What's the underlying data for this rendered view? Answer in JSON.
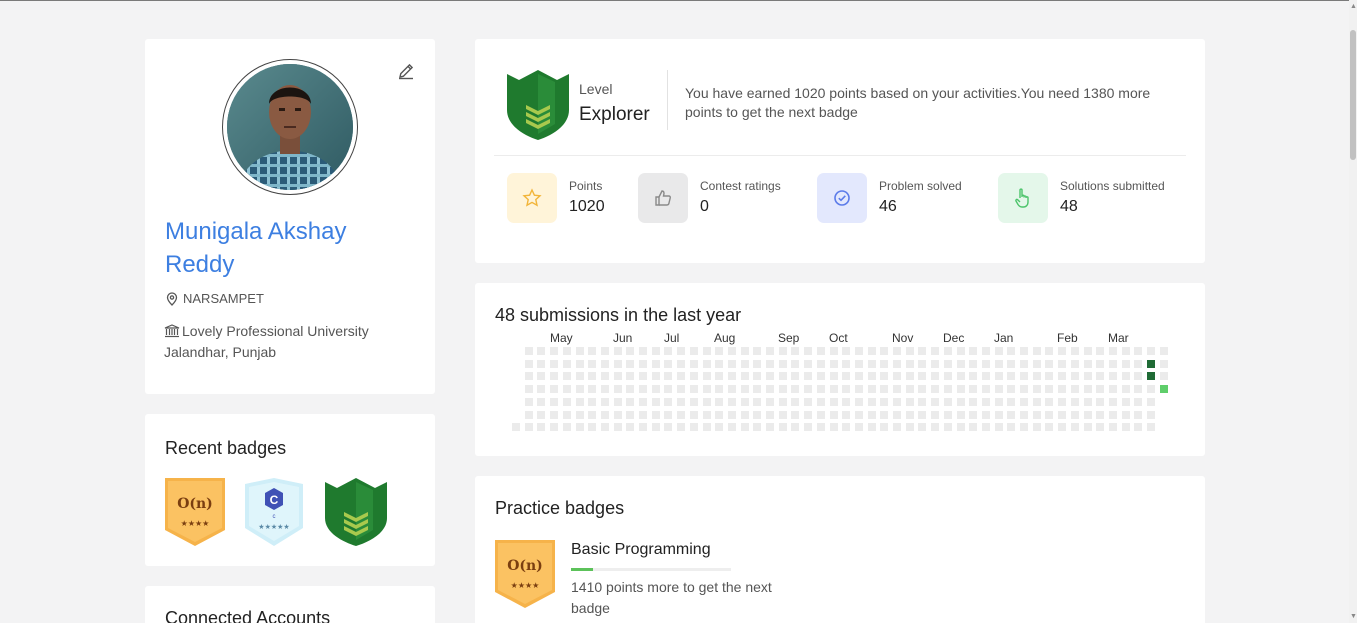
{
  "profile": {
    "name": "Munigala Akshay Reddy",
    "location": "NARSAMPET",
    "university": "Lovely Professional University Jalandhar, Punjab",
    "edit_icon": "pencil-icon",
    "location_icon": "map-pin-icon",
    "university_icon": "institution-icon"
  },
  "recent_badges": {
    "title": "Recent badges",
    "items": [
      {
        "name": "big-o-badge",
        "text": "O(n)",
        "stars": "★★★★"
      },
      {
        "name": "c-language-badge",
        "text": "C",
        "sub": "c",
        "stars": "★★★★★"
      },
      {
        "name": "explorer-badge"
      }
    ]
  },
  "connected": {
    "title": "Connected Accounts"
  },
  "level": {
    "label": "Level",
    "name": "Explorer",
    "description": "You have earned 1020 points based on your activities.You need 1380 more points to get the next badge"
  },
  "stats": [
    {
      "label": "Points",
      "value": "1020",
      "icon": "star-icon",
      "bg": "#fff4d9",
      "color": "#f2b53a"
    },
    {
      "label": "Contest ratings",
      "value": "0",
      "icon": "thumbs-up-icon",
      "bg": "#e9e9ea",
      "color": "#8a8a8a"
    },
    {
      "label": "Problem solved",
      "value": "46",
      "icon": "check-circle-icon",
      "bg": "#e3e8fd",
      "color": "#5b7be9"
    },
    {
      "label": "Solutions submitted",
      "value": "48",
      "icon": "pointer-hand-icon",
      "bg": "#e4f7ea",
      "color": "#4cc46b"
    }
  ],
  "submissions": {
    "title": "48 submissions in the last year",
    "months": [
      "May",
      "Jun",
      "Jul",
      "Aug",
      "Sep",
      "Oct",
      "Nov",
      "Dec",
      "Jan",
      "Feb",
      "Mar"
    ],
    "colors": {
      "empty": "#ebebeb",
      "high": "#1f6b35",
      "low": "#5fce6b"
    }
  },
  "practice": {
    "title": "Practice badges",
    "badge_text": "O(n)",
    "badge_stars": "★★★★",
    "badge_title": "Basic Programming",
    "progress": 0.14,
    "next_text": "1410 points more to get the next badge"
  }
}
